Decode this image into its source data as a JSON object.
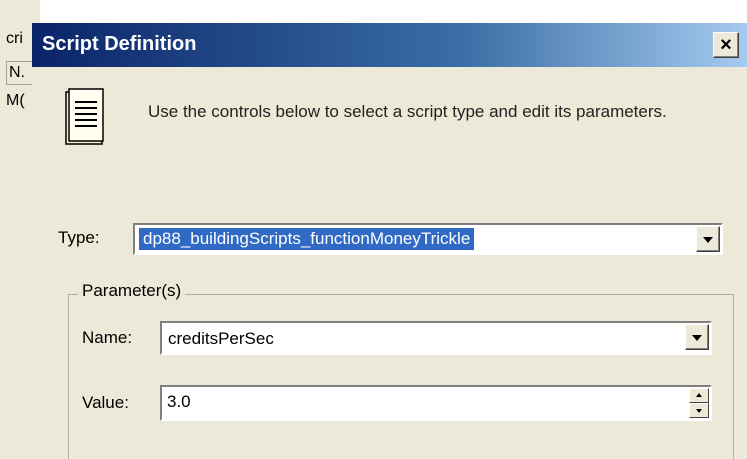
{
  "background_window": {
    "fragments": [
      "cri",
      "N.",
      "M("
    ]
  },
  "dialog": {
    "title": "Script Definition",
    "close_glyph": "×",
    "icon": "note-pad-icon",
    "intro": "Use the controls below to select a script type and edit its parameters.",
    "type_label": "Type:",
    "type_value": "dp88_buildingScripts_functionMoneyTrickle",
    "group_label": "Parameter(s)",
    "name_label": "Name:",
    "name_value": "creditsPerSec",
    "value_label": "Value:",
    "value_value": "3.0"
  },
  "colors": {
    "title_gradient_start": "#0a246a",
    "title_gradient_end": "#a6caf0",
    "selection": "#316ac5",
    "dialog_bg": "#ece9d8"
  }
}
